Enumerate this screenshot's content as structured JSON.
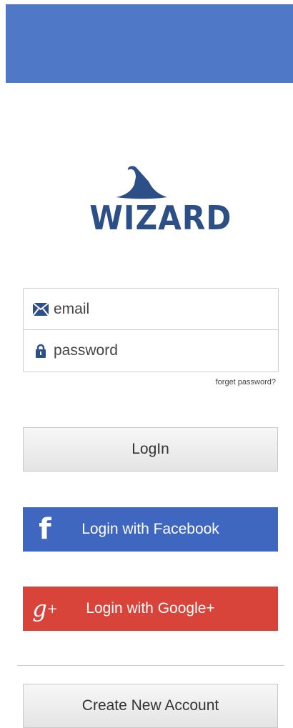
{
  "brand": {
    "name": "WIZARD",
    "color": "#2d4f87",
    "header_color": "#4f79c6"
  },
  "form": {
    "email": {
      "placeholder": "email",
      "value": ""
    },
    "password": {
      "placeholder": "password",
      "value": ""
    },
    "forgot_label": "forget password?"
  },
  "buttons": {
    "login": "LogIn",
    "facebook": "Login with Facebook",
    "google": "Login with Google+",
    "create": "Create New Account"
  },
  "colors": {
    "facebook": "#3f67bf",
    "google": "#d8443a"
  },
  "icons": {
    "email": "envelope-icon",
    "password": "lock-icon",
    "facebook": "facebook-icon",
    "google": "google-plus-icon",
    "logo": "wizard-hat-icon"
  }
}
